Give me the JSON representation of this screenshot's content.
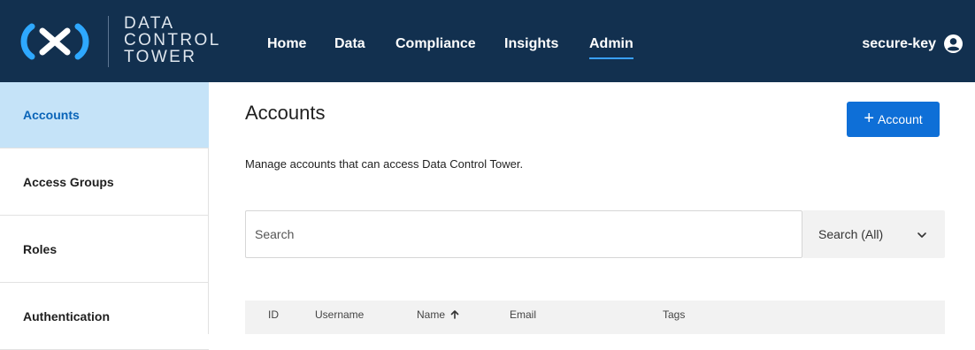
{
  "brand": {
    "line1": "DATA",
    "line2": "CONTROL",
    "line3": "TOWER",
    "color": "#12304f",
    "accent": "#3aa0ff"
  },
  "nav": {
    "items": [
      {
        "label": "Home",
        "active": false
      },
      {
        "label": "Data",
        "active": false
      },
      {
        "label": "Compliance",
        "active": false
      },
      {
        "label": "Insights",
        "active": false
      },
      {
        "label": "Admin",
        "active": true
      }
    ]
  },
  "user": {
    "name": "secure-key",
    "icon": "user-circle-icon"
  },
  "sidebar": {
    "items": [
      {
        "label": "Accounts",
        "active": true
      },
      {
        "label": "Access Groups",
        "active": false
      },
      {
        "label": "Roles",
        "active": false
      },
      {
        "label": "Authentication",
        "active": false
      }
    ]
  },
  "main": {
    "title": "Accounts",
    "add_button": {
      "plus": "+",
      "label": "Account",
      "color": "#0e6fd7"
    },
    "description": "Manage accounts that can access Data Control Tower.",
    "search": {
      "placeholder": "Search",
      "scope": "Search (All)"
    },
    "table": {
      "columns": [
        "ID",
        "Username",
        "Name",
        "Email",
        "Tags"
      ],
      "sort_column": "Name",
      "sort_direction": "ascending"
    }
  }
}
